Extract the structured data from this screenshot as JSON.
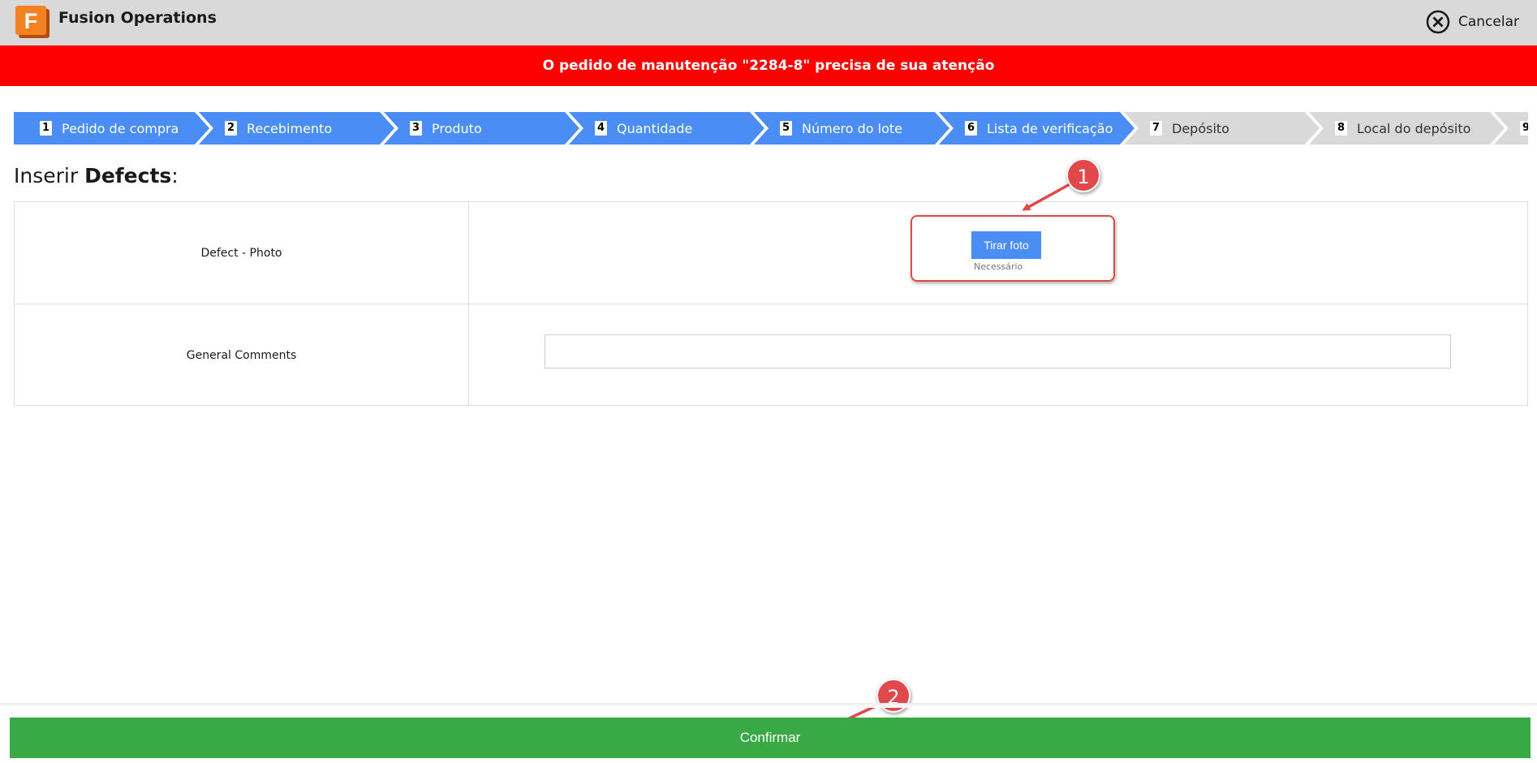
{
  "header": {
    "app_title": "Fusion Operations",
    "logo_letter": "F",
    "cancel_label": "Cancelar"
  },
  "alert": {
    "message": "O pedido de manutenção \"2284-8\" precisa de sua atenção"
  },
  "steps": [
    {
      "num": "1",
      "label": "Pedido de compra",
      "state": "done"
    },
    {
      "num": "2",
      "label": "Recebimento",
      "state": "done"
    },
    {
      "num": "3",
      "label": "Produto",
      "state": "done"
    },
    {
      "num": "4",
      "label": "Quantidade",
      "state": "done"
    },
    {
      "num": "5",
      "label": "Número do lote",
      "state": "done"
    },
    {
      "num": "6",
      "label": "Lista de verificação",
      "state": "done"
    },
    {
      "num": "7",
      "label": "Depósito",
      "state": "todo"
    },
    {
      "num": "8",
      "label": "Local do depósito",
      "state": "todo"
    },
    {
      "num": "9",
      "label": "",
      "state": "todo"
    }
  ],
  "page": {
    "title_prefix": "Inserir",
    "title_bold": "Defects",
    "title_suffix": ":"
  },
  "form": {
    "photo_label": "Defect - Photo",
    "photo_button": "Tirar foto",
    "photo_hint": "Necessário",
    "comments_label": "General Comments",
    "comments_value": ""
  },
  "annotations": {
    "badge1": "1",
    "badge2": "2"
  },
  "footer": {
    "confirm_label": "Confirmar"
  },
  "colors": {
    "step_done": "#4a8ef5",
    "step_todo": "#d9d9d9",
    "alert": "#ff0000",
    "confirm": "#38a945",
    "annotation": "#e0484a"
  }
}
